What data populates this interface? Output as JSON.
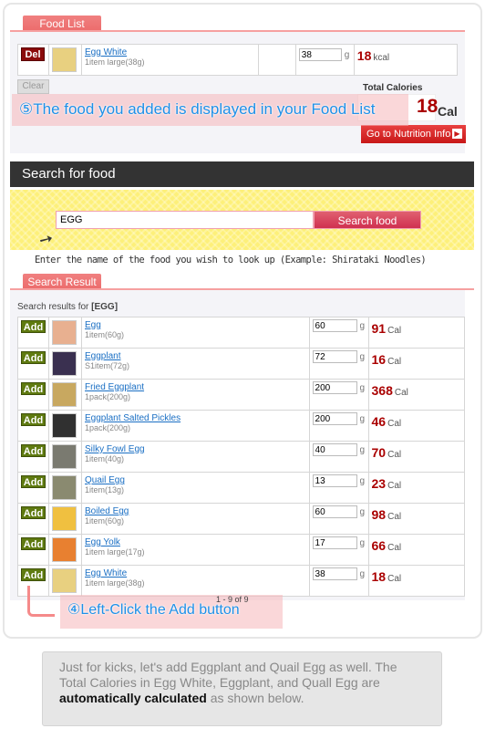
{
  "food_list": {
    "tab_label": "Food List",
    "item": {
      "del_label": "Del",
      "name": "Egg White",
      "portion": "1item large(38g)",
      "qty": "38",
      "unit_g": "g",
      "cal": "18",
      "cal_unit": "kcal"
    },
    "clear_label": "Clear",
    "total_label": "Total Calories",
    "total_value": "18",
    "total_unit": "Cal",
    "nutrition_button": "Go to Nutrition Info"
  },
  "annotation_5": "⑤The food you added is displayed in your Food List",
  "search": {
    "title": "Search for food",
    "input_value": "EGG",
    "button_label": "Search food",
    "hint": "Enter the name of the food you wish to look up (Example: Shirataki Noodles)"
  },
  "results": {
    "tab_label": "Search Result",
    "caption_prefix": "Search results for ",
    "caption_query": "[EGG]",
    "add_label": "Add",
    "unit_g": "g",
    "cal_unit": "Cal",
    "rows": [
      {
        "name": "Egg",
        "portion": "1item(60g)",
        "qty": "60",
        "cal": "91",
        "img": "#e8b090"
      },
      {
        "name": "Eggplant",
        "portion": "S1item(72g)",
        "qty": "72",
        "cal": "16",
        "img": "#3a3050"
      },
      {
        "name": "Fried Eggplant",
        "portion": "1pack(200g)",
        "qty": "200",
        "cal": "368",
        "img": "#c8a860"
      },
      {
        "name": "Eggplant Salted Pickles",
        "portion": "1pack(200g)",
        "qty": "200",
        "cal": "46",
        "img": "#303030"
      },
      {
        "name": "Silky Fowl Egg",
        "portion": "1item(40g)",
        "qty": "40",
        "cal": "70",
        "img": "#7a7a70"
      },
      {
        "name": "Quail Egg",
        "portion": "1item(13g)",
        "qty": "13",
        "cal": "23",
        "img": "#8a8a70"
      },
      {
        "name": "Boiled Egg",
        "portion": "1item(60g)",
        "qty": "60",
        "cal": "98",
        "img": "#f0c040"
      },
      {
        "name": "Egg Yolk",
        "portion": "1item large(17g)",
        "qty": "17",
        "cal": "66",
        "img": "#e88030"
      },
      {
        "name": "Egg White",
        "portion": "1item large(38g)",
        "qty": "38",
        "cal": "18",
        "img": "#e8d080"
      }
    ],
    "pagination": "1 - 9 of 9"
  },
  "annotation_4": "④Left-Click the Add button",
  "footer_note": {
    "text_before": "Just for kicks, let's add Eggplant and Quail Egg as well. The Total Calories in Egg White, Eggplant, and Quall Egg are ",
    "bold": "automatically calculated",
    "text_after": " as shown below."
  },
  "colors": {
    "accent": "#ec6b6b",
    "cal": "#aa0000",
    "add": "#5f7a10",
    "del": "#8b0a0a",
    "link": "#1a6fc4"
  }
}
